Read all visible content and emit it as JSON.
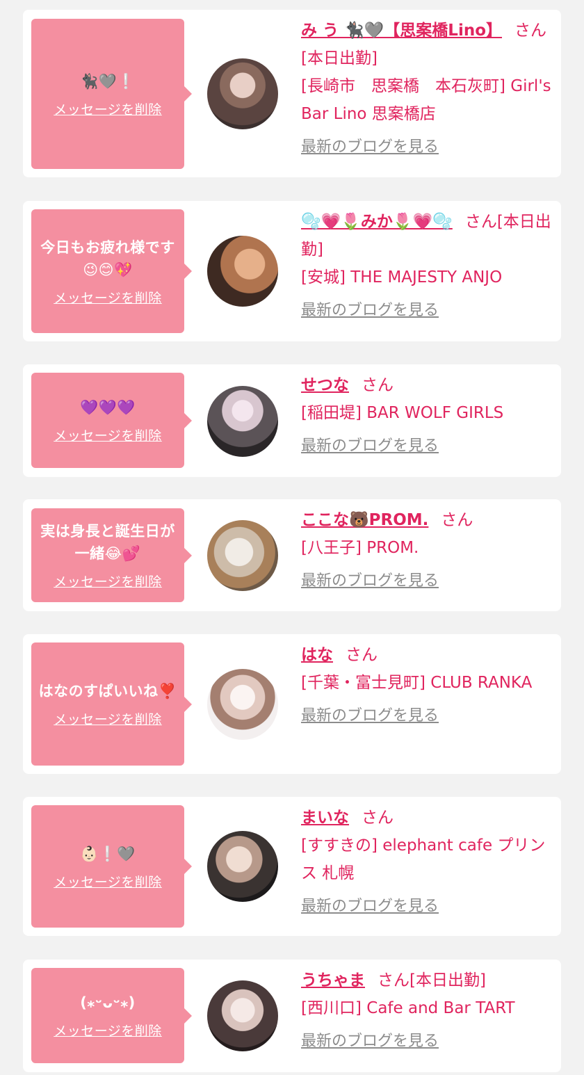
{
  "delete_label": "メッセージを削除",
  "blog_label": "最新のブログを見る",
  "colors": {
    "background": "#f2f2f2",
    "card": "#ffffff",
    "bubble": "#f48fa0",
    "accent_pink": "#e0245e",
    "link_gray": "#8c8c8c"
  },
  "items": [
    {
      "message": "🐈‍⬛🩶❕",
      "name": "み う 🐈‍⬛🩶【思案橋Lino】",
      "suffix": "さん[本日出勤]",
      "shop": "[長崎市　思案橋　本石灰町] Girl's Bar Lino 思案橋店"
    },
    {
      "message": "今日もお疲れ様です😉😊💖",
      "name": "🫧💗🌷みか🌷💗🫧",
      "suffix": "さん[本日出勤]",
      "shop": "[安城] THE MAJESTY ANJO"
    },
    {
      "message": "💜💜💜",
      "name": "せつな",
      "suffix": "さん",
      "shop": "[稲田堤] BAR WOLF GIRLS"
    },
    {
      "message": "実は身長と誕生日が一緒😂💕",
      "name": "ここな🐻PROM.",
      "suffix": "さん",
      "shop": "[八王子] PROM."
    },
    {
      "message": "はなのすぱいいね❣️",
      "name": "はな",
      "suffix": "さん",
      "shop": "[千葉・富士見町] CLUB RANKA"
    },
    {
      "message": "👶🏻❕🩶",
      "name": "まいな",
      "suffix": "さん",
      "shop": "[すすきの] elephant cafe プリンス 札幌"
    },
    {
      "message": "(⁎ᵕᴗᵕ⁎)",
      "name": "うちゃま",
      "suffix": "さん[本日出勤]",
      "shop": "[西川口] Cafe and Bar TART"
    }
  ]
}
